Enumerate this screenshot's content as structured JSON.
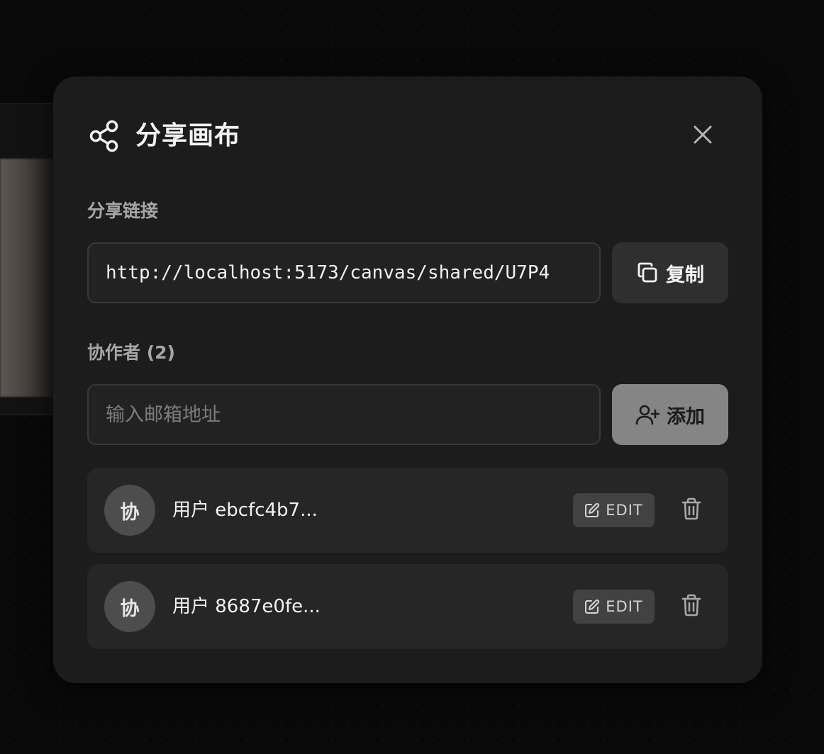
{
  "modal": {
    "title": "分享画布",
    "share_icon": "share-icon",
    "close_icon": "close-icon"
  },
  "share_link": {
    "label": "分享链接",
    "value": "http://localhost:5173/canvas/shared/U7P4",
    "copy_button": {
      "label": "复制",
      "icon": "copy-icon"
    }
  },
  "collaborators": {
    "label": "协作者 (2)",
    "email_input": {
      "placeholder": "输入邮箱地址",
      "value": ""
    },
    "add_button": {
      "label": "添加",
      "icon": "user-plus-icon"
    },
    "items": [
      {
        "avatar": "协",
        "name": "用户 ebcfc4b7...",
        "role_button": "EDIT",
        "role_icon": "edit-icon",
        "delete_icon": "trash-icon"
      },
      {
        "avatar": "协",
        "name": "用户 8687e0fe...",
        "role_button": "EDIT",
        "role_icon": "edit-icon",
        "delete_icon": "trash-icon"
      }
    ]
  },
  "colors": {
    "backdrop": "#090909",
    "modal_bg": "#1c1c1c",
    "field_bg": "#222222",
    "row_bg": "#262626",
    "add_button_bg": "#858585",
    "avatar_bg": "#4d4d4d"
  }
}
